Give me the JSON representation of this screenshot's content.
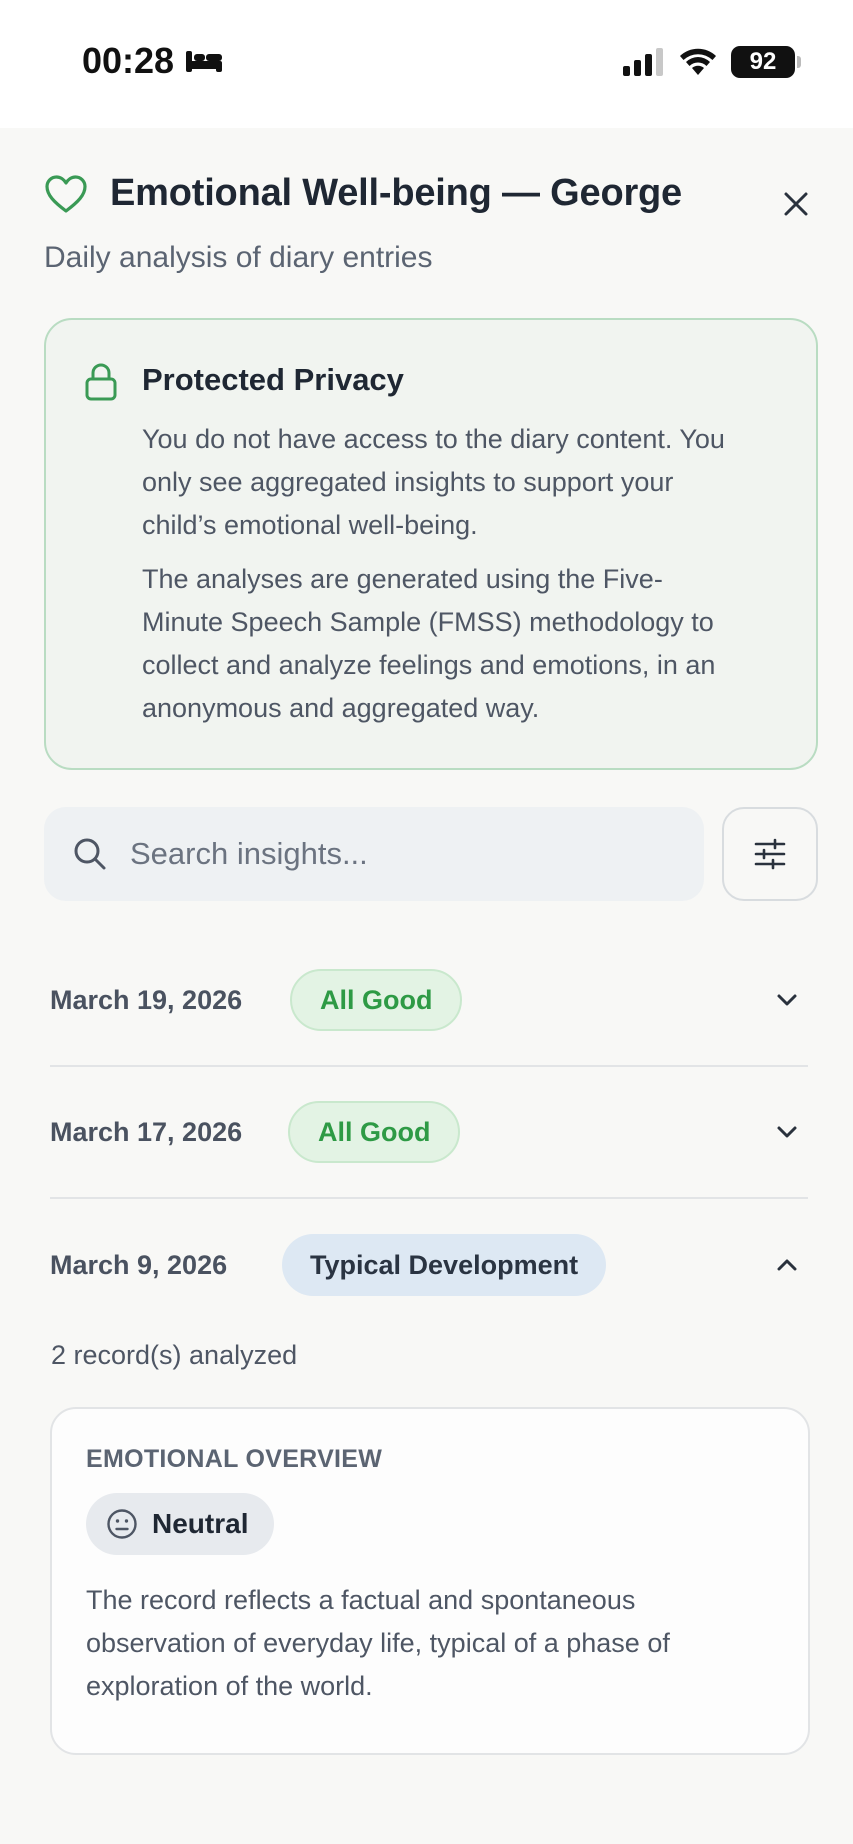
{
  "status_bar": {
    "time": "00:28",
    "battery": "92"
  },
  "header": {
    "title": "Emotional Well-being — George",
    "subtitle": "Daily analysis of diary entries"
  },
  "privacy": {
    "title": "Protected Privacy",
    "paragraph1": "You do not have access to the diary content. You only see aggregated insights to support your child’s emotional well-being.",
    "paragraph2": "The analyses are generated using the Five-Minute Speech Sample (FMSS) methodology to collect and analyze feelings and emotions, in an anonymous and aggregated way."
  },
  "search": {
    "placeholder": "Search insights...",
    "value": ""
  },
  "entries": [
    {
      "date": "March 19, 2026",
      "badge": "All Good",
      "expanded": false
    },
    {
      "date": "March 17, 2026",
      "badge": "All Good",
      "expanded": false
    },
    {
      "date": "March 9, 2026",
      "badge": "Typical Development",
      "expanded": true
    }
  ],
  "expanded_entry": {
    "records_count": "2 record(s) analyzed",
    "overview_label": "EMOTIONAL OVERVIEW",
    "mood": "Neutral",
    "description": "The record reflects a factual and spontaneous observation of everyday life, typical of a phase of exploration of the world."
  },
  "colors": {
    "accent_green": "#2e9a45",
    "good_badge_bg": "#e3f3e4",
    "typical_badge_bg": "#dde8f3",
    "privacy_card_bg": "#f1f4f0"
  }
}
